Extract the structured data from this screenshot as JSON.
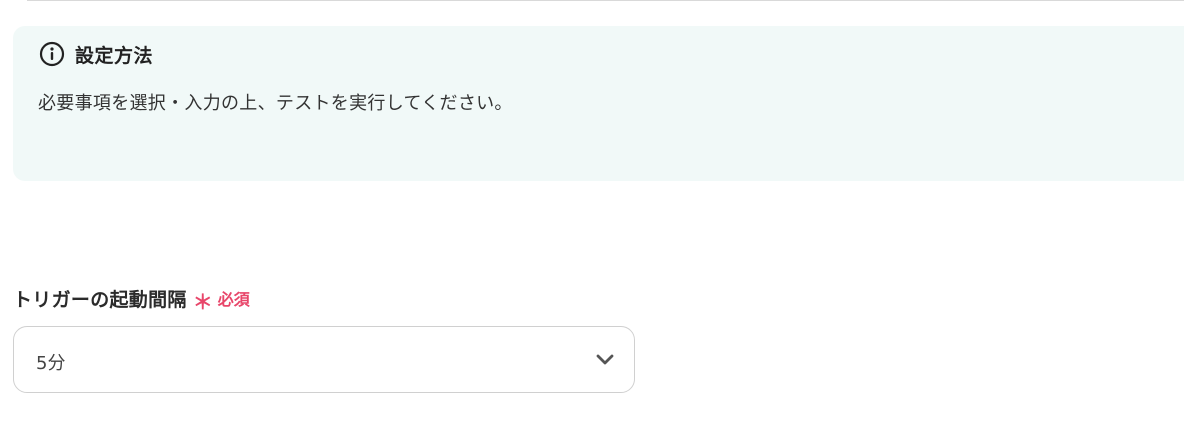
{
  "info": {
    "title": "設定方法",
    "description": "必要事項を選択・入力の上、テストを実行してください。",
    "icon": "info-icon"
  },
  "field": {
    "label": "トリガーの起動間隔",
    "required_mark": "＊",
    "required_text": "必須",
    "selected_value": "5分",
    "dropdown_icon": "chevron-down-icon"
  },
  "colors": {
    "info_background": "#f1f9f8",
    "required": "#e8466a",
    "border": "#d0d0d0"
  }
}
